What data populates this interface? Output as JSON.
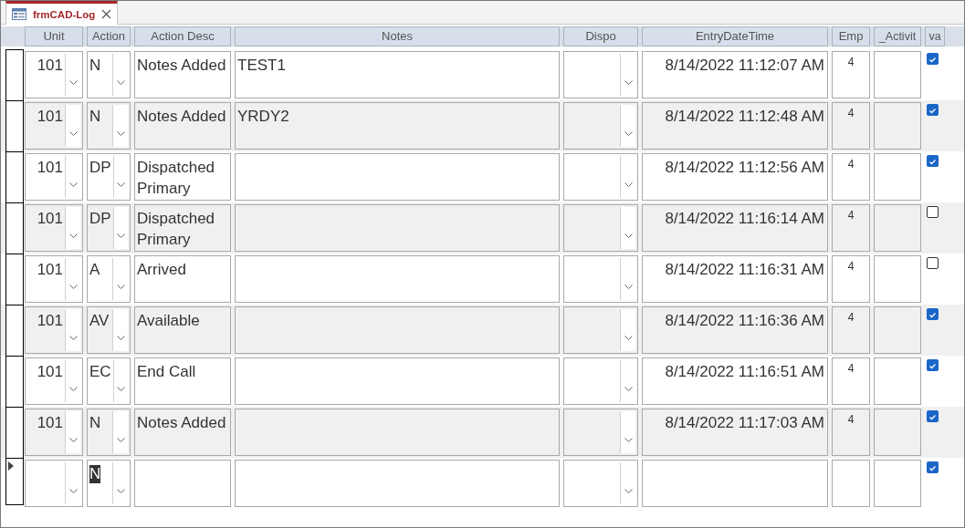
{
  "tab": {
    "title": "frmCAD-Log",
    "selected": true
  },
  "columns": [
    "Unit",
    "Action",
    "Action Desc",
    "Notes",
    "Dispo",
    "EntryDateTime",
    "Emp",
    "_Activit",
    "va"
  ],
  "rows": [
    {
      "unit": "101",
      "action": "N",
      "action_desc": "Notes Added",
      "notes": "TEST1",
      "entry": "8/14/2022 11:12:07 AM",
      "emp": "4",
      "checked": true,
      "selected": false,
      "action_highlighted": false
    },
    {
      "unit": "101",
      "action": "N",
      "action_desc": "Notes Added",
      "notes": "YRDY2",
      "entry": "8/14/2022 11:12:48 AM",
      "emp": "4",
      "checked": true,
      "selected": false,
      "action_highlighted": false
    },
    {
      "unit": "101",
      "action": "DP",
      "action_desc": "Dispatched Primary",
      "entry": "8/14/2022 11:12:56 AM",
      "emp": "4",
      "checked": true,
      "selected": false,
      "action_highlighted": false
    },
    {
      "unit": "101",
      "action": "DP",
      "action_desc": "Dispatched Primary",
      "entry": "8/14/2022 11:16:14 AM",
      "emp": "4",
      "checked": false,
      "selected": false,
      "action_highlighted": false
    },
    {
      "unit": "101",
      "action": "A",
      "action_desc": "Arrived",
      "entry": "8/14/2022 11:16:31 AM",
      "emp": "4",
      "checked": false,
      "selected": false,
      "action_highlighted": false
    },
    {
      "unit": "101",
      "action": "AV",
      "action_desc": "Available",
      "entry": "8/14/2022 11:16:36 AM",
      "emp": "4",
      "checked": true,
      "selected": false,
      "action_highlighted": false
    },
    {
      "unit": "101",
      "action": "EC",
      "action_desc": "End Call",
      "entry": "8/14/2022 11:16:51 AM",
      "emp": "4",
      "checked": true,
      "selected": false,
      "action_highlighted": false
    },
    {
      "unit": "101",
      "action": "N",
      "action_desc": "Notes Added",
      "entry": "8/14/2022 11:17:03 AM",
      "emp": "4",
      "checked": true,
      "selected": false,
      "action_highlighted": false
    },
    {
      "action": "N",
      "checked": true,
      "selected": true,
      "action_highlighted": true
    }
  ]
}
